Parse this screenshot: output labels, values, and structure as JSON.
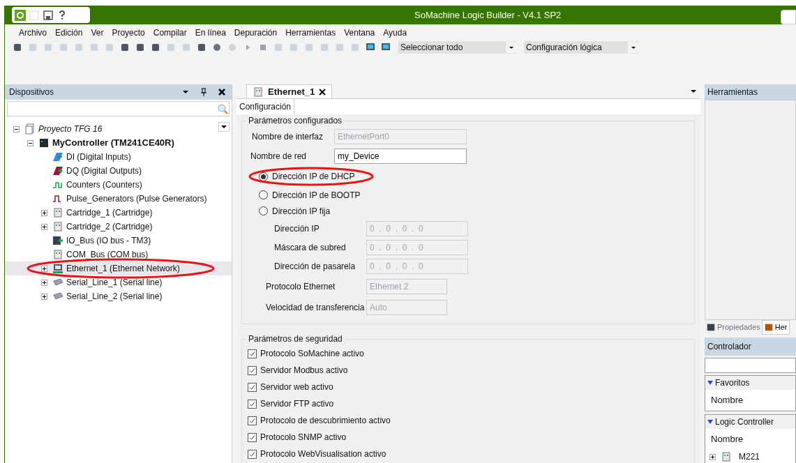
{
  "window": {
    "title": "SoMachine Logic Builder - V4.1 SP2"
  },
  "menu": [
    "Archivo",
    "Edición",
    "Ver",
    "Proyecto",
    "Compilar",
    "En línea",
    "Depuración",
    "Herramientas",
    "Ventana",
    "Ayuda"
  ],
  "toolbar": {
    "dropdowns": [
      "Seleccionar todo",
      "Configuración lógica"
    ]
  },
  "devices_panel": {
    "title": "Dispositivos",
    "tree": [
      {
        "kind": "project",
        "label": "Proyecto TFG 16",
        "expanded": true,
        "selected": false,
        "children": [
          {
            "kind": "controller",
            "label": "MyController (TM241CE40R)",
            "expanded": true,
            "selected": false,
            "children": [
              {
                "kind": "input",
                "label": "DI (Digital Inputs)",
                "selected": false
              },
              {
                "kind": "output",
                "label": "DQ (Digital Outputs)",
                "selected": false
              },
              {
                "kind": "counter",
                "label": "Counters (Counters)",
                "selected": false
              },
              {
                "kind": "pulse",
                "label": "Pulse_Generators (Pulse Generators)",
                "selected": false
              },
              {
                "kind": "cartridge",
                "label": "Cartridge_1 (Cartridge)",
                "expanded": false,
                "selected": false
              },
              {
                "kind": "cartridge",
                "label": "Cartridge_2 (Cartridge)",
                "expanded": false,
                "selected": false
              },
              {
                "kind": "bus",
                "label": "IO_Bus (IO bus - TM3)",
                "selected": false
              },
              {
                "kind": "cartridge",
                "label": "COM_Bus (COM bus)",
                "selected": false
              },
              {
                "kind": "ethernet",
                "label": "Ethernet_1 (Ethernet Network)",
                "expanded": false,
                "selected": true,
                "circled": true
              },
              {
                "kind": "serial",
                "label": "Serial_Line_1 (Serial line)",
                "expanded": false,
                "selected": false
              },
              {
                "kind": "serial",
                "label": "Serial_Line_2 (Serial line)",
                "expanded": false,
                "selected": false
              }
            ]
          }
        ]
      }
    ]
  },
  "editor": {
    "tab": "Ethernet_1",
    "subtabs": [
      {
        "label": "Configuración",
        "selected": true
      }
    ],
    "configured": {
      "title": "Parámetros configurados",
      "interface_name": {
        "label": "Nombre de interfaz",
        "value": "EthernetPort0",
        "disabled": true
      },
      "network_name": {
        "label": "Nombre de red",
        "value": "my_Device",
        "disabled": false
      },
      "ip_modes": [
        {
          "label": "Dirección IP de DHCP",
          "selected": true,
          "circled": true
        },
        {
          "label": "Dirección IP de BOOTP",
          "selected": false,
          "circled": false
        },
        {
          "label": "Dirección IP fija",
          "selected": false,
          "circled": false
        }
      ],
      "ip_fields": [
        {
          "label": "Dirección IP",
          "value": "0  .  0  .  0  .  0",
          "disabled": true
        },
        {
          "label": "Máscara de subred",
          "value": "0  .  0  .  0  .  0",
          "disabled": true
        },
        {
          "label": "Dirección de pasarela",
          "value": "0  .  0  .  0  .  0",
          "disabled": true
        }
      ],
      "protocol": {
        "label": "Protocolo Ethernet",
        "value": "Ethernet 2",
        "disabled": true
      },
      "speed": {
        "label": "Velocidad de transferencia",
        "value": "Auto",
        "disabled": true
      }
    },
    "security": {
      "title": "Parámetros de seguridad",
      "options": [
        {
          "label": "Protocolo SoMachine activo",
          "checked": true
        },
        {
          "label": "Servidor Modbus activo",
          "checked": true
        },
        {
          "label": "Servidor web activo",
          "checked": true
        },
        {
          "label": "Servidor FTP activo",
          "checked": true
        },
        {
          "label": "Protocolo de descubrimiento activo",
          "checked": true
        },
        {
          "label": "Protocolo SNMP activo",
          "checked": true
        },
        {
          "label": "Protocolo WebVisualisation activo",
          "checked": true
        }
      ]
    }
  },
  "tools_panel": {
    "title": "Herramientas",
    "tabs": [
      {
        "label": "Propiedades",
        "selected": false
      },
      {
        "label": "Her",
        "selected": true
      }
    ]
  },
  "controller_panel": {
    "title": "Controlador",
    "sections": [
      {
        "title": "Favoritos",
        "column": "Nombre"
      },
      {
        "title": "Logic Controller",
        "column": "Nombre",
        "items": [
          {
            "label": "M221",
            "expanded": false
          }
        ]
      }
    ]
  }
}
